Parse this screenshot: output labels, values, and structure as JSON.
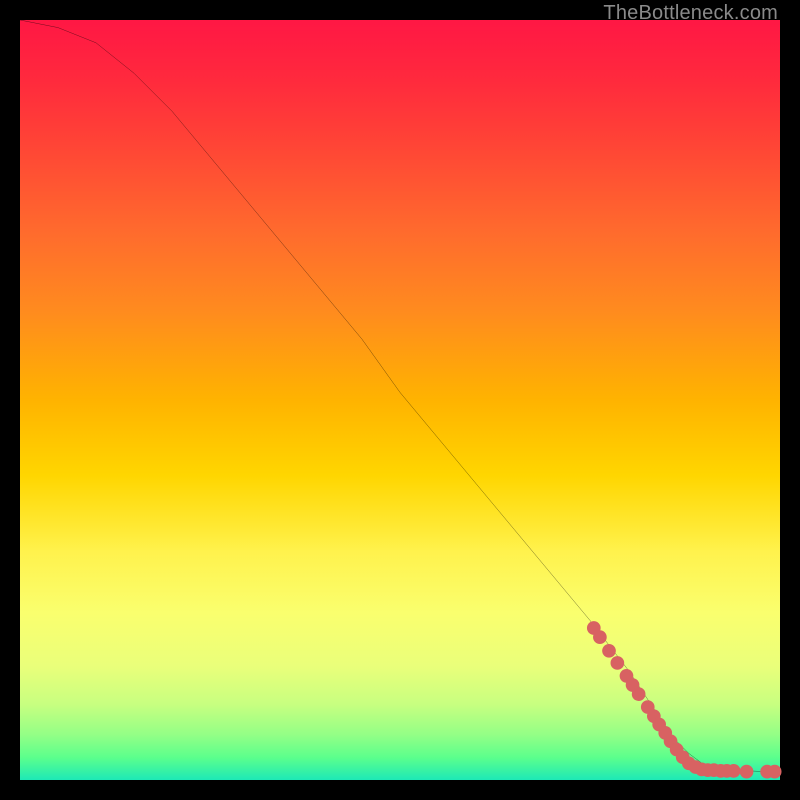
{
  "watermark": "TheBottleneck.com",
  "colors": {
    "background": "#000000",
    "curve": "#000000",
    "marker": "#d86262",
    "watermark": "#8a8a8a"
  },
  "chart_data": {
    "type": "line",
    "title": "",
    "xlabel": "",
    "ylabel": "",
    "xlim": [
      0,
      100
    ],
    "ylim": [
      0,
      100
    ],
    "grid": false,
    "legend": false,
    "series": [
      {
        "name": "curve",
        "x": [
          0,
          5,
          10,
          15,
          20,
          25,
          30,
          35,
          40,
          45,
          50,
          55,
          60,
          65,
          70,
          75,
          80,
          84,
          86,
          88,
          90,
          92,
          94,
          96,
          98,
          100
        ],
        "y": [
          100,
          99,
          97,
          93,
          88,
          82,
          76,
          70,
          64,
          58,
          51,
          45,
          39,
          33,
          27,
          21,
          14.5,
          8.5,
          5.5,
          3.5,
          2,
          1.5,
          1.3,
          1.2,
          1.1,
          1.1
        ]
      }
    ],
    "markers": [
      {
        "x": 75.5,
        "y": 20.0
      },
      {
        "x": 76.3,
        "y": 18.8
      },
      {
        "x": 77.5,
        "y": 17.0
      },
      {
        "x": 78.6,
        "y": 15.4
      },
      {
        "x": 79.8,
        "y": 13.7
      },
      {
        "x": 80.6,
        "y": 12.5
      },
      {
        "x": 81.4,
        "y": 11.3
      },
      {
        "x": 82.6,
        "y": 9.6
      },
      {
        "x": 83.4,
        "y": 8.4
      },
      {
        "x": 84.1,
        "y": 7.3
      },
      {
        "x": 84.9,
        "y": 6.2
      },
      {
        "x": 85.6,
        "y": 5.1
      },
      {
        "x": 86.4,
        "y": 4.0
      },
      {
        "x": 87.2,
        "y": 3.0
      },
      {
        "x": 88.0,
        "y": 2.2
      },
      {
        "x": 88.9,
        "y": 1.7
      },
      {
        "x": 89.7,
        "y": 1.4
      },
      {
        "x": 90.5,
        "y": 1.3
      },
      {
        "x": 91.3,
        "y": 1.3
      },
      {
        "x": 92.2,
        "y": 1.2
      },
      {
        "x": 93.0,
        "y": 1.2
      },
      {
        "x": 93.9,
        "y": 1.2
      },
      {
        "x": 95.6,
        "y": 1.1
      },
      {
        "x": 98.3,
        "y": 1.1
      },
      {
        "x": 99.3,
        "y": 1.1
      }
    ],
    "marker_radius_data_units": 0.9
  }
}
